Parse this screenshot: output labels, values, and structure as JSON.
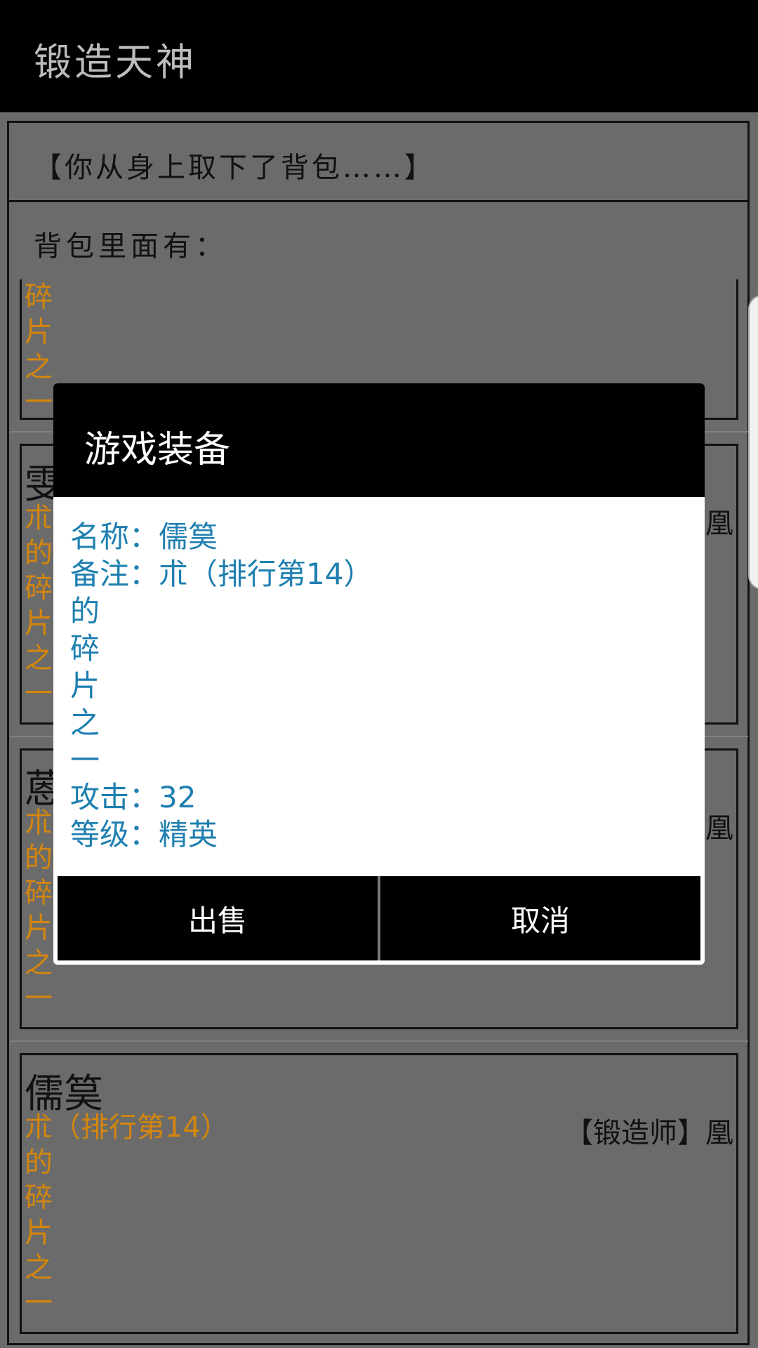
{
  "app": {
    "title": "锻造天神"
  },
  "message": "【你从身上取下了背包……】",
  "bag_label": "背包里面有：",
  "cards": [
    {
      "name": "",
      "desc_lines": [
        "碎",
        "片",
        "之",
        "一"
      ],
      "maker": ""
    },
    {
      "name": "雯",
      "desc_first": "朮",
      "desc_lines": [
        "的",
        "碎",
        "片",
        "之",
        "一"
      ],
      "maker": "凰"
    },
    {
      "name": "蒽",
      "desc_first": "朮",
      "desc_lines": [
        "的",
        "碎",
        "片",
        "之",
        "一"
      ],
      "maker": "凰"
    },
    {
      "name": "儒筽",
      "desc_first": "朮（排行第14）",
      "desc_lines": [
        "的",
        "碎",
        "片",
        "之",
        "一"
      ],
      "maker": "【锻造师】凰"
    }
  ],
  "dialog": {
    "title": "游戏装备",
    "name_line": "名称：儒筽",
    "note_line": "备注：朮（排行第14）",
    "note_lines": [
      "的",
      "碎",
      "片",
      "之",
      "一"
    ],
    "attack_line": "攻击：32",
    "level_line": "等级：精英",
    "sell_label": "出售",
    "cancel_label": "取消"
  },
  "colors": {
    "accent_orange": "#d4860c",
    "dialog_text_blue": "#1e7fb0"
  }
}
